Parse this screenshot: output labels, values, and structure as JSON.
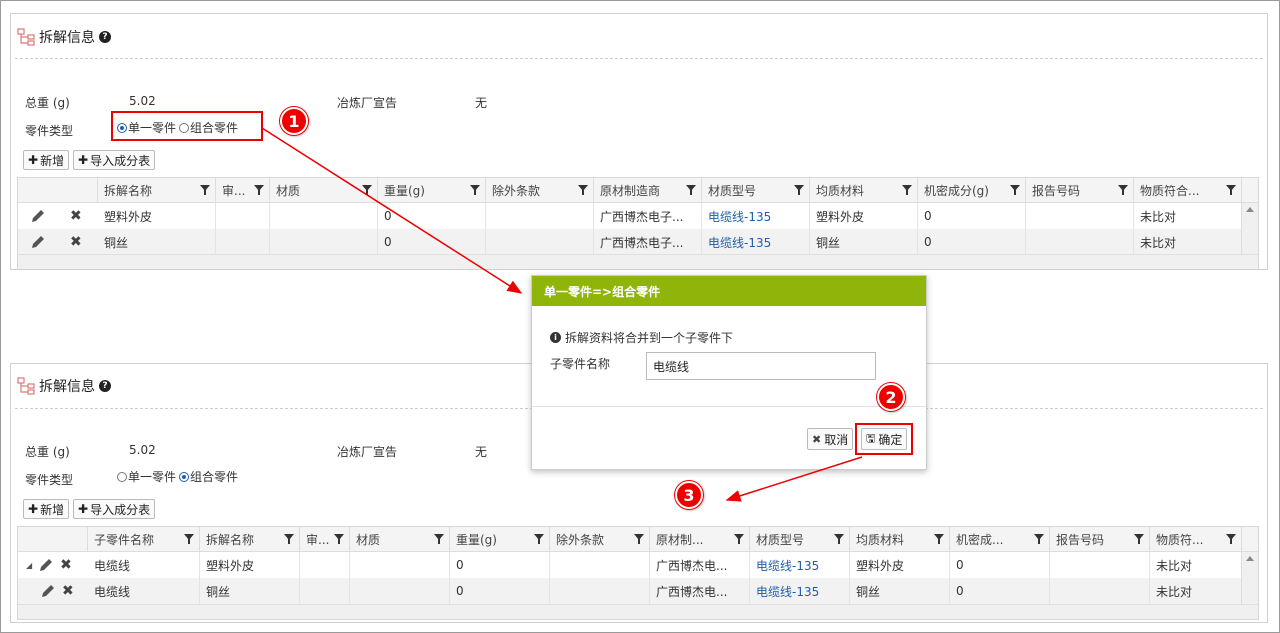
{
  "top": {
    "title": "拆解信息",
    "help": "?",
    "weight_label": "总重 (g)",
    "weight_value": "5.02",
    "smelter_label": "冶炼厂宣告",
    "smelter_value": "无",
    "part_type_label": "零件类型",
    "radio_single": "单一零件",
    "radio_combo": "组合零件",
    "selected": "单一零件",
    "add_button": "新增",
    "import_button": "导入成分表",
    "columns": [
      "拆解名称",
      "审...",
      "材质",
      "重量(g)",
      "除外条款",
      "原材制造商",
      "材质型号",
      "均质材料",
      "机密成分(g)",
      "报告号码",
      "物质符合..."
    ],
    "rows": [
      [
        "塑料外皮",
        "",
        "",
        "0",
        "",
        "广西博杰电子...",
        "电缆线-135",
        "塑料外皮",
        "0",
        "",
        "未比对"
      ],
      [
        "铜丝",
        "",
        "",
        "0",
        "",
        "广西博杰电子...",
        "电缆线-135",
        "铜丝",
        "0",
        "",
        "未比对"
      ]
    ]
  },
  "bottom": {
    "title": "拆解信息",
    "help": "?",
    "weight_label": "总重 (g)",
    "weight_value": "5.02",
    "smelter_label": "冶炼厂宣告",
    "smelter_value": "无",
    "part_type_label": "零件类型",
    "radio_single": "单一零件",
    "radio_combo": "组合零件",
    "selected": "组合零件",
    "add_button": "新增",
    "import_button": "导入成分表",
    "columns": [
      "子零件名称",
      "拆解名称",
      "审...",
      "材质",
      "重量(g)",
      "除外条款",
      "原材制...",
      "材质型号",
      "均质材料",
      "机密成...",
      "报告号码",
      "物质符..."
    ],
    "rows": [
      [
        "电缆线",
        "塑料外皮",
        "",
        "",
        "0",
        "",
        "广西博杰电...",
        "电缆线-135",
        "塑料外皮",
        "0",
        "",
        "未比对"
      ],
      [
        "电缆线",
        "铜丝",
        "",
        "",
        "0",
        "",
        "广西博杰电...",
        "电缆线-135",
        "铜丝",
        "0",
        "",
        "未比对"
      ]
    ]
  },
  "dialog": {
    "title": "单一零件=>组合零件",
    "info": "拆解资料将合并到一个子零件下",
    "field_label": "子零件名称",
    "field_value": "电缆线",
    "cancel": "取消",
    "confirm": "确定"
  },
  "annotations": {
    "badge1": "1",
    "badge2": "2",
    "badge3": "3",
    "color": "#e00000"
  }
}
